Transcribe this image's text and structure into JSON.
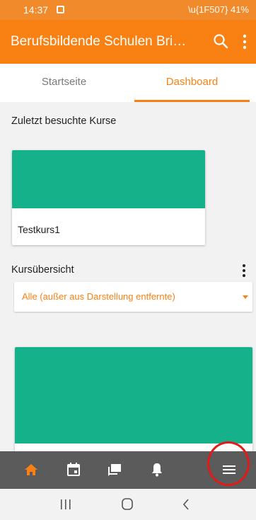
{
  "status_bar": {
    "time": "14:37",
    "battery": "41%",
    "icons": [
      "image-notification-icon",
      "mute-icon",
      "wifi-icon",
      "signal-icon",
      "battery-icon"
    ]
  },
  "app_bar": {
    "title": "Berufsbildende Schulen Bri…"
  },
  "tabs": [
    {
      "label": "Startseite",
      "active": false
    },
    {
      "label": "Dashboard",
      "active": true
    }
  ],
  "recent": {
    "heading": "Zuletzt besuchte Kurse",
    "courses": [
      {
        "name": "Testkurs1"
      }
    ]
  },
  "overview": {
    "heading": "Kursübersicht",
    "filter": {
      "selected": "Alle (außer aus Darstellung entfernte)"
    }
  },
  "bottom_nav": [
    "home-icon",
    "calendar-icon",
    "messages-icon",
    "notifications-icon",
    "menu-icon"
  ],
  "system_nav": [
    "recent-apps-icon",
    "home-system-icon",
    "back-icon"
  ],
  "colors": {
    "brand": "#f98012",
    "course_image": "#14b18a",
    "bottom_nav": "#5b5b5b",
    "highlight": "#e01919"
  }
}
